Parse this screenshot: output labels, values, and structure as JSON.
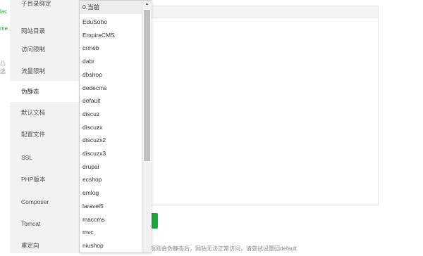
{
  "left_fragments": [
    "lac",
    "me",
    "凸选"
  ],
  "sidebar": {
    "items": [
      {
        "label": "子目录绑定"
      },
      {
        "label": "网站目录"
      },
      {
        "label": "访问限制"
      },
      {
        "label": "流量限制"
      },
      {
        "label": "伪静态",
        "active": true
      },
      {
        "label": "默认文档"
      },
      {
        "label": "配置文件"
      },
      {
        "label": "SSL"
      },
      {
        "label": "PHP版本"
      },
      {
        "label": "Composer"
      },
      {
        "label": "Tomcat"
      },
      {
        "label": "重定向"
      }
    ]
  },
  "rewrite_dropdown": {
    "selected": "0.当前",
    "options": [
      "0.当前",
      "EduSoho",
      "EmpireCMS",
      "crmeb",
      "dabr",
      "dbshop",
      "dedecms",
      "default",
      "discuz",
      "discuzx",
      "discuzx2",
      "discuzx3",
      "drupal",
      "ecshop",
      "emlog",
      "laravel5",
      "maccms",
      "mvc",
      "niushop"
    ]
  },
  "footer_note": "…规则会伪静态后，网站无法正常访问，请尝试设置回default",
  "colors": {
    "accent": "#20a53a",
    "sidebar_bg": "#f2f2f2"
  }
}
